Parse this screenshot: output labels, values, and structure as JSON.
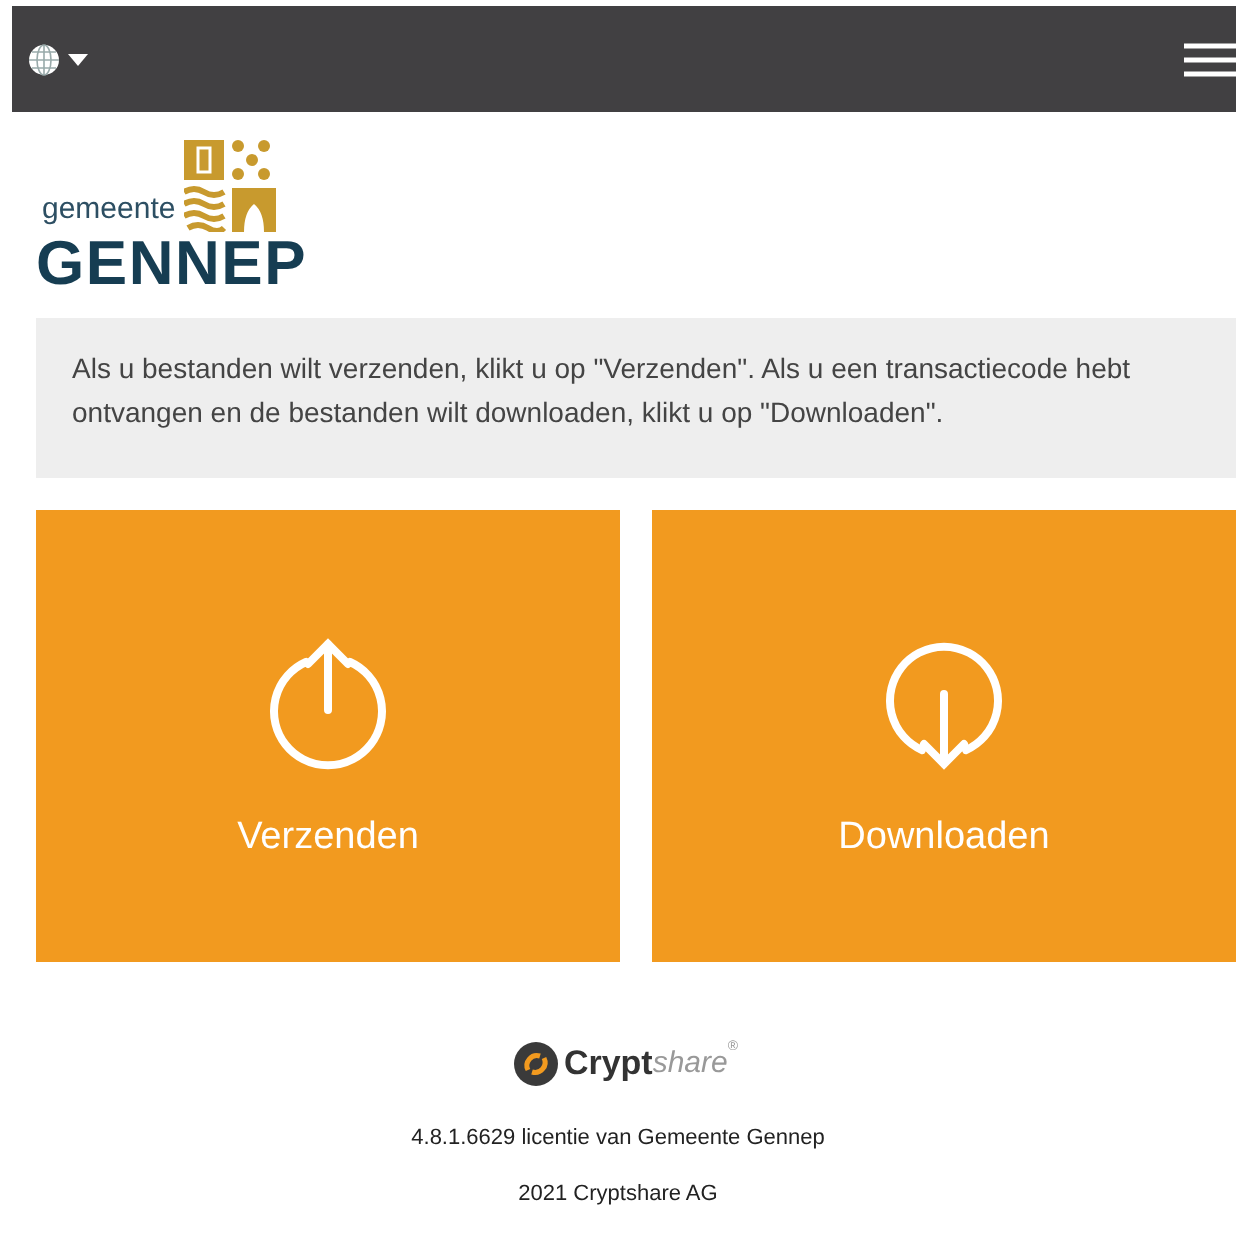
{
  "logo": {
    "line1": "gemeente",
    "line2": "GENNEP"
  },
  "info": "Als u bestanden wilt verzenden, klikt u op \"Verzenden\". Als u een transactiecode hebt ontvangen en de bestanden wilt downloaden, klikt u op \"Downloaden\".",
  "tiles": [
    {
      "kind": "upload",
      "label": "Verzenden"
    },
    {
      "kind": "download",
      "label": "Downloaden"
    }
  ],
  "footer": {
    "brand_bold": "Crypt",
    "brand_light": "share",
    "brand_mark": "®",
    "license": "4.8.1.6629 licentie van Gemeente Gennep",
    "copyright": "2021 Cryptshare AG"
  }
}
